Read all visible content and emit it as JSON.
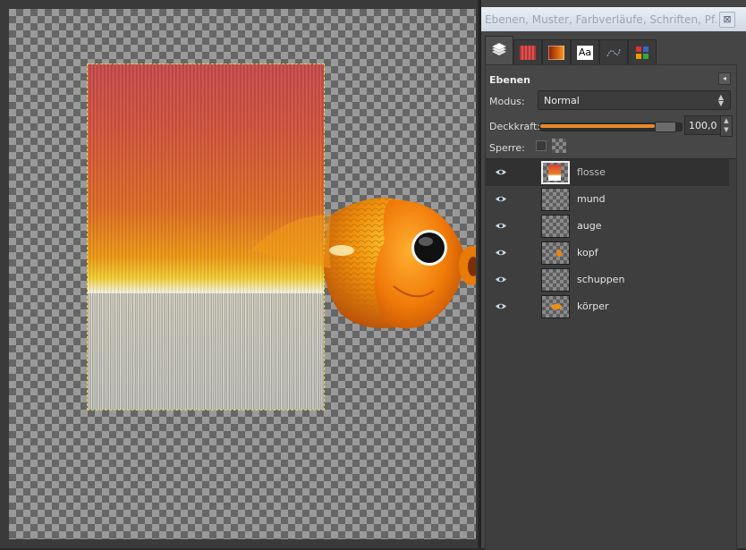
{
  "dock": {
    "title": "Ebenen, Muster, Farbverläufe, Schriften, Pf...",
    "close_glyph": "⊠"
  },
  "tabs": [
    {
      "name": "layers-tab",
      "icon": "layers-icon",
      "active": true
    },
    {
      "name": "patterns-tab",
      "icon": "pattern-icon",
      "active": false
    },
    {
      "name": "gradients-tab",
      "icon": "gradient-icon",
      "active": false
    },
    {
      "name": "fonts-tab",
      "icon": "font-icon",
      "label": "Aa",
      "active": false
    },
    {
      "name": "paths-tab",
      "icon": "paths-icon",
      "active": false
    },
    {
      "name": "colors-tab",
      "icon": "palette-icon",
      "active": false
    }
  ],
  "layers_panel": {
    "title": "Ebenen",
    "mode_label": "Modus:",
    "mode_value": "Normal",
    "opacity_label": "Deckkraft:",
    "opacity_value": "100,0",
    "opacity_fraction": 1.0,
    "lock_label": "Sperre:"
  },
  "layers": [
    {
      "name": "flosse",
      "selected": true,
      "thumb": "fin"
    },
    {
      "name": "mund",
      "selected": false,
      "thumb": "empty"
    },
    {
      "name": "auge",
      "selected": false,
      "thumb": "empty"
    },
    {
      "name": "kopf",
      "selected": false,
      "thumb": "head"
    },
    {
      "name": "schuppen",
      "selected": false,
      "thumb": "empty"
    },
    {
      "name": "körper",
      "selected": false,
      "thumb": "body"
    }
  ],
  "colors": {
    "accent": "#e88a2a",
    "fish_orange": "#f08a10",
    "selection_outline": "#e8d84a"
  }
}
